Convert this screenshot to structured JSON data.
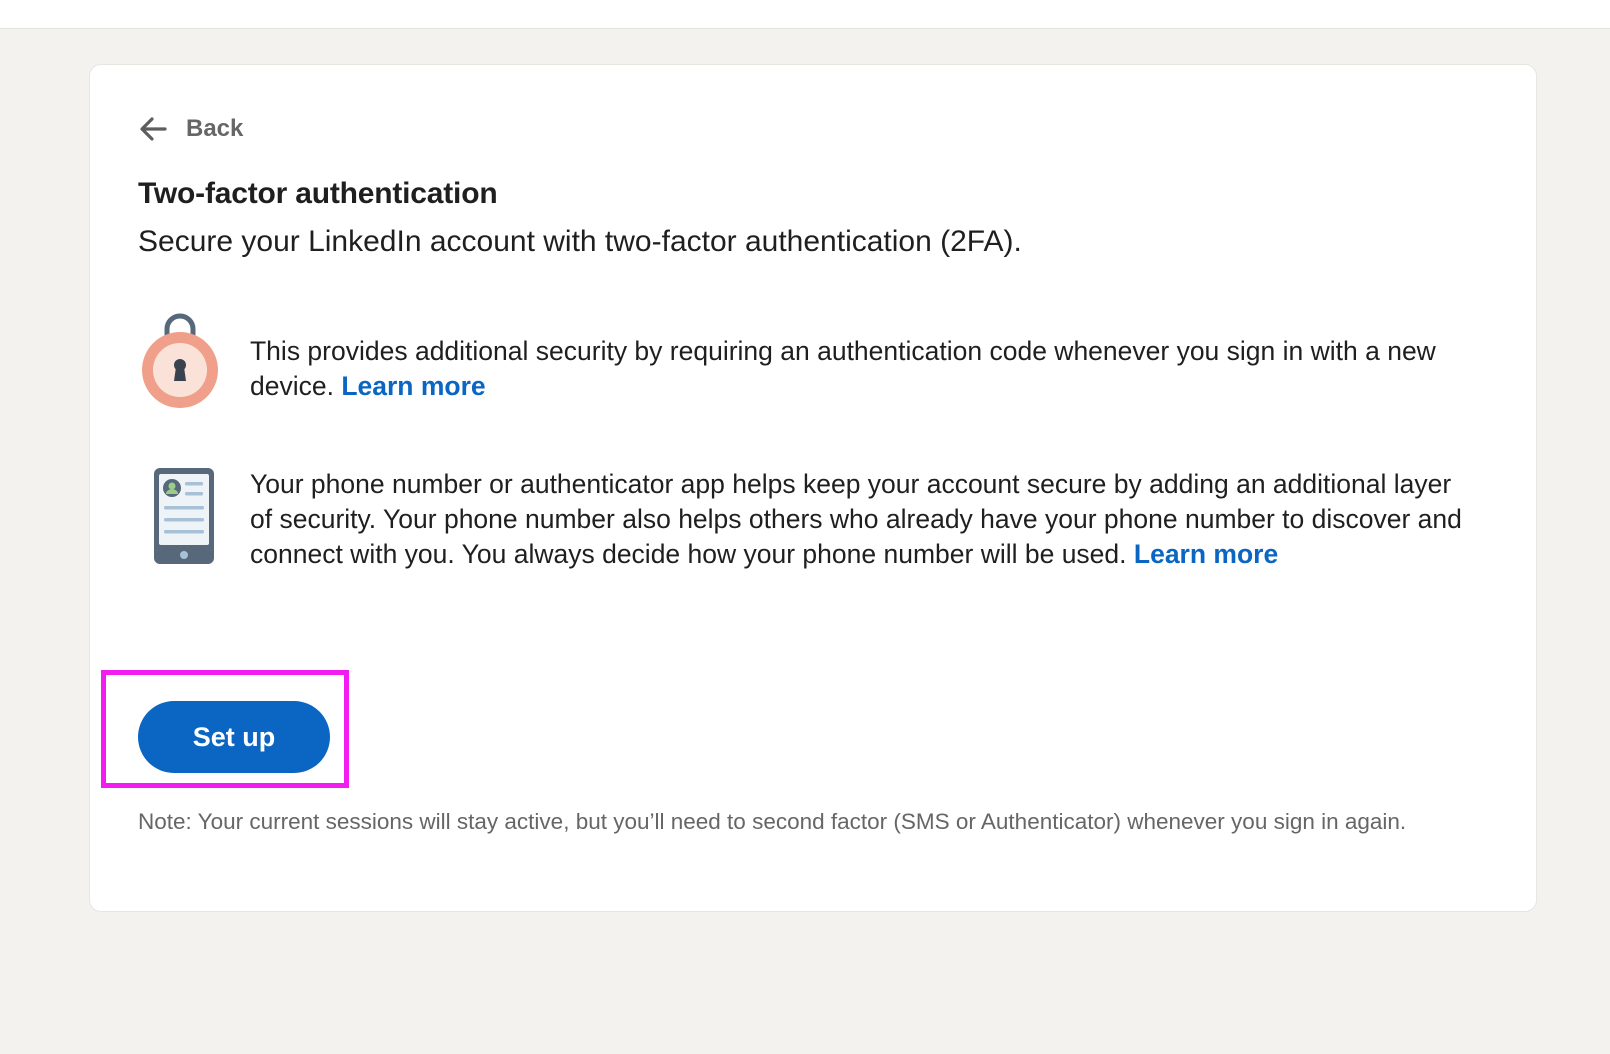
{
  "back": {
    "label": "Back"
  },
  "header": {
    "title": "Two-factor authentication",
    "subtitle": "Secure your LinkedIn account with two-factor authentication (2FA)."
  },
  "features": [
    {
      "icon": "lock-icon",
      "text": "This provides additional security by requiring an authentication code whenever you sign in with a new device. ",
      "link": "Learn more"
    },
    {
      "icon": "phone-icon",
      "text": "Your phone number or authenticator app helps keep your account secure by adding an additional layer of security. Your phone number also helps others who already have your phone number to discover and connect with you. You always decide how your phone number will be used. ",
      "link": "Learn more"
    }
  ],
  "setup_button": {
    "label": "Set up"
  },
  "note": "Note: Your current sessions will stay active, but you’ll need to second factor (SMS or Authenticator) whenever you sign in again.",
  "colors": {
    "accent": "#0a66c2",
    "highlight": "#f21bf0",
    "lock": "#f0a08a",
    "page_bg": "#f3f2ef"
  }
}
